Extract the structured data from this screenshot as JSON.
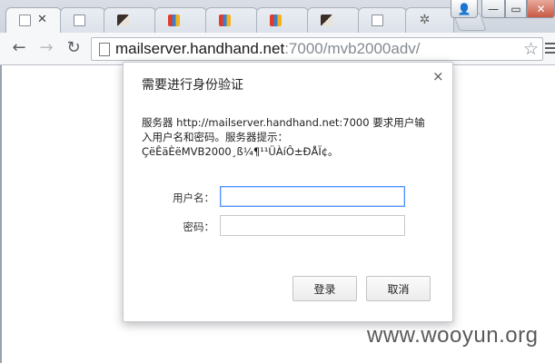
{
  "browser": {
    "tabs": [
      {
        "icon": "blank-page-icon",
        "close": "✕",
        "active": true
      },
      {
        "icon": "blank-page-icon"
      },
      {
        "icon": "app-favicon-icon"
      },
      {
        "icon": "grid-favicon-icon"
      },
      {
        "icon": "grid-favicon-icon"
      },
      {
        "icon": "grid-favicon-icon"
      },
      {
        "icon": "app-favicon-icon"
      },
      {
        "icon": "blank-page-icon"
      },
      {
        "icon": "gear-icon"
      }
    ],
    "window_controls": {
      "user": "👤",
      "minimize": "—",
      "maximize": "▭",
      "close": "✕"
    },
    "nav": {
      "back": "←",
      "forward": "→",
      "reload": "↻"
    },
    "url_host": "mailserver.handhand.net",
    "url_rest": ":7000/mvb2000adv/",
    "bookmark": "☆"
  },
  "dialog": {
    "title": "需要进行身份验证",
    "close": "×",
    "message_line1": "服务器 http://mailserver.handhand.net:7000 要求用户输",
    "message_line2": "入用户名和密码。服务器提示：",
    "message_line3": "ÇëÊäÈëMVB2000¸ß¼¶¹¹ÜÀíÔ±ÐÅÏ¢。",
    "username_label": "用户名：",
    "password_label": "密码：",
    "username_value": "",
    "password_value": "",
    "login_button": "登录",
    "cancel_button": "取消"
  },
  "watermark": "www.wooyun.org"
}
